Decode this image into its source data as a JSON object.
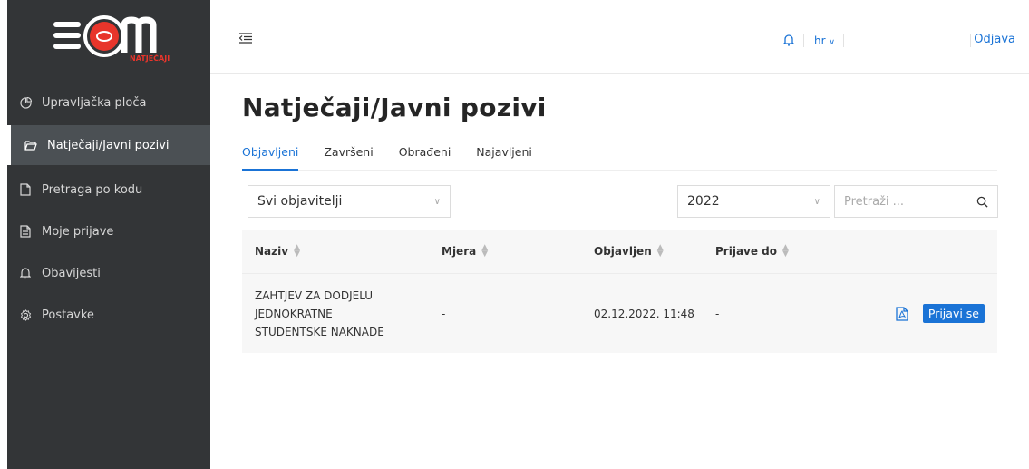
{
  "logo": {
    "main_text": "SOM",
    "sub_text": "NATJEČAJI"
  },
  "sidebar": {
    "items": [
      {
        "label": "Upravljačka ploča",
        "icon": "pie-chart-icon"
      },
      {
        "label": "Natječaji/Javni pozivi",
        "icon": "folder-open-icon",
        "active": true
      },
      {
        "label": "Pretraga po kodu",
        "icon": "file-icon"
      },
      {
        "label": "Moje prijave",
        "icon": "file-text-icon"
      },
      {
        "label": "Obavijesti",
        "icon": "bell-icon"
      },
      {
        "label": "Postavke",
        "icon": "gear-icon"
      }
    ]
  },
  "header": {
    "language": "hr",
    "logout": "Odjava"
  },
  "main": {
    "title": "Natječaji/Javni pozivi",
    "tabs": [
      {
        "label": "Objavljeni",
        "active": true
      },
      {
        "label": "Završeni"
      },
      {
        "label": "Obrađeni"
      },
      {
        "label": "Najavljeni"
      }
    ],
    "filters": {
      "publisher": "Svi objavitelji",
      "year": "2022",
      "search_placeholder": "Pretraži ..."
    },
    "table": {
      "columns": [
        "Naziv",
        "Mjera",
        "Objavljen",
        "Prijave do"
      ],
      "rows": [
        {
          "naziv": "ZAHTJEV ZA DODJELU JEDNOKRATNE STUDENTSKE NAKNADE",
          "mjera": "-",
          "objavljen": "02.12.2022. 11:48",
          "prijave_do": "-",
          "action": "Prijavi se"
        }
      ]
    }
  },
  "colors": {
    "accent": "#1a73d6",
    "sidebar": "#333537",
    "logo_red": "#e8352b"
  }
}
